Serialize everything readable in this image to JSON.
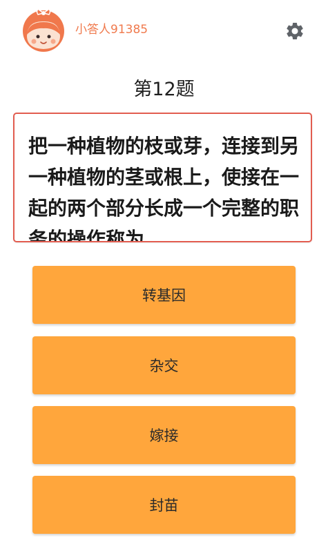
{
  "header": {
    "username": "小答人91385",
    "avatar_icon": "girl-avatar-icon",
    "settings_icon": "gear-icon"
  },
  "question": {
    "title": "第12题",
    "text": "把一种植物的枝或芽，连接到另一种植物的茎或根上，使接在一起的两个部分长成一个完整的职务的操作称为"
  },
  "options": [
    {
      "label": "转基因"
    },
    {
      "label": "杂交"
    },
    {
      "label": "嫁接"
    },
    {
      "label": "封苗"
    }
  ],
  "colors": {
    "accent": "#f07a4d",
    "question_border": "#e25c4f",
    "option_bg": "#ffa63c"
  }
}
